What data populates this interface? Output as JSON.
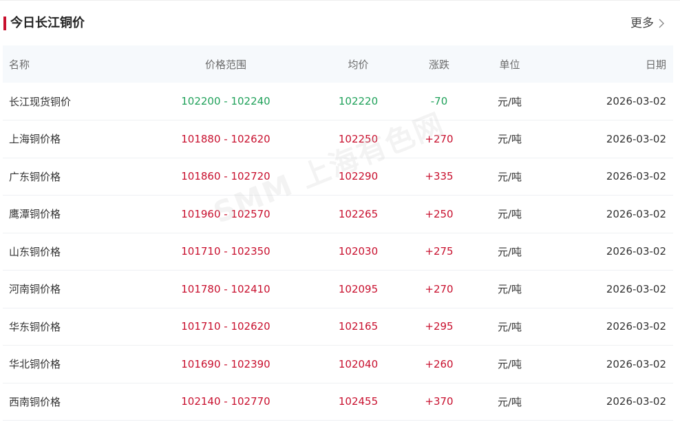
{
  "header": {
    "title": "今日长江铜价",
    "more_label": "更多"
  },
  "colors": {
    "accent": "#c8102e",
    "up": "#c8102e",
    "down": "#20a15a",
    "header_bg": "#f6f9fc"
  },
  "table": {
    "columns": [
      "名称",
      "价格范围",
      "均价",
      "涨跌",
      "单位",
      "日期"
    ],
    "rows": [
      {
        "name": "长江现货铜价",
        "range": "102200 - 102240",
        "avg": "102220",
        "change": "-70",
        "unit": "元/吨",
        "date": "2026-03-02"
      },
      {
        "name": "上海铜价格",
        "range": "101880 - 102620",
        "avg": "102250",
        "change": "+270",
        "unit": "元/吨",
        "date": "2026-03-02"
      },
      {
        "name": "广东铜价格",
        "range": "101860 - 102720",
        "avg": "102290",
        "change": "+335",
        "unit": "元/吨",
        "date": "2026-03-02"
      },
      {
        "name": "鹰潭铜价格",
        "range": "101960 - 102570",
        "avg": "102265",
        "change": "+250",
        "unit": "元/吨",
        "date": "2026-03-02"
      },
      {
        "name": "山东铜价格",
        "range": "101710 - 102350",
        "avg": "102030",
        "change": "+275",
        "unit": "元/吨",
        "date": "2026-03-02"
      },
      {
        "name": "河南铜价格",
        "range": "101780 - 102410",
        "avg": "102095",
        "change": "+270",
        "unit": "元/吨",
        "date": "2026-03-02"
      },
      {
        "name": "华东铜价格",
        "range": "101710 - 102620",
        "avg": "102165",
        "change": "+295",
        "unit": "元/吨",
        "date": "2026-03-02"
      },
      {
        "name": "华北铜价格",
        "range": "101690 - 102390",
        "avg": "102040",
        "change": "+260",
        "unit": "元/吨",
        "date": "2026-03-02"
      },
      {
        "name": "西南铜价格",
        "range": "102140 - 102770",
        "avg": "102455",
        "change": "+370",
        "unit": "元/吨",
        "date": "2026-03-02"
      }
    ]
  },
  "watermark": "SMM 上海有色网"
}
